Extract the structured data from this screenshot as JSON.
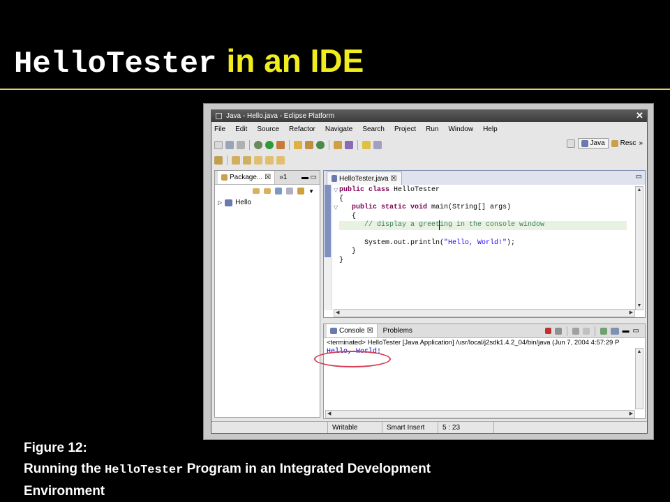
{
  "slide": {
    "title_code": "HelloTester",
    "title_rest": "in an IDE",
    "caption_line1": "Figure 12:",
    "caption_pre": "Running the ",
    "caption_code": "HelloTester",
    "caption_post": " Program  in an Integrated Development",
    "caption_line3": "Environment"
  },
  "window": {
    "title": "Java - Hello.java - Eclipse Platform",
    "close_label": "✕"
  },
  "menus": [
    "File",
    "Edit",
    "Source",
    "Refactor",
    "Navigate",
    "Search",
    "Project",
    "Run",
    "Window",
    "Help"
  ],
  "perspectives": {
    "java": "Java",
    "resource": "Resc",
    "more": "»"
  },
  "package_explorer": {
    "tab_label": "Package...",
    "tab_close": "☒",
    "hierarchy_label": "»1",
    "project": "Hello"
  },
  "editor": {
    "tab_label": "HelloTester.java",
    "tab_close": "☒"
  },
  "console": {
    "tab_label": "Console",
    "tab_close": "☒",
    "problems_label": "Problems",
    "terminated_line": "<terminated> HelloTester [Java Application] /usr/local/j2sdk1.4.2_04/bin/java (Jun 7, 2004 4:57:29 P",
    "output": "Hello, World!"
  },
  "statusbar": {
    "writable": "Writable",
    "insert_mode": "Smart Insert",
    "position": "5 : 23"
  },
  "colors": {
    "title_accent": "#f0ec1e",
    "keyword": "#7f0055",
    "comment": "#3f7f5f",
    "string": "#2a00ff",
    "highlight_oval": "#d93a55"
  }
}
